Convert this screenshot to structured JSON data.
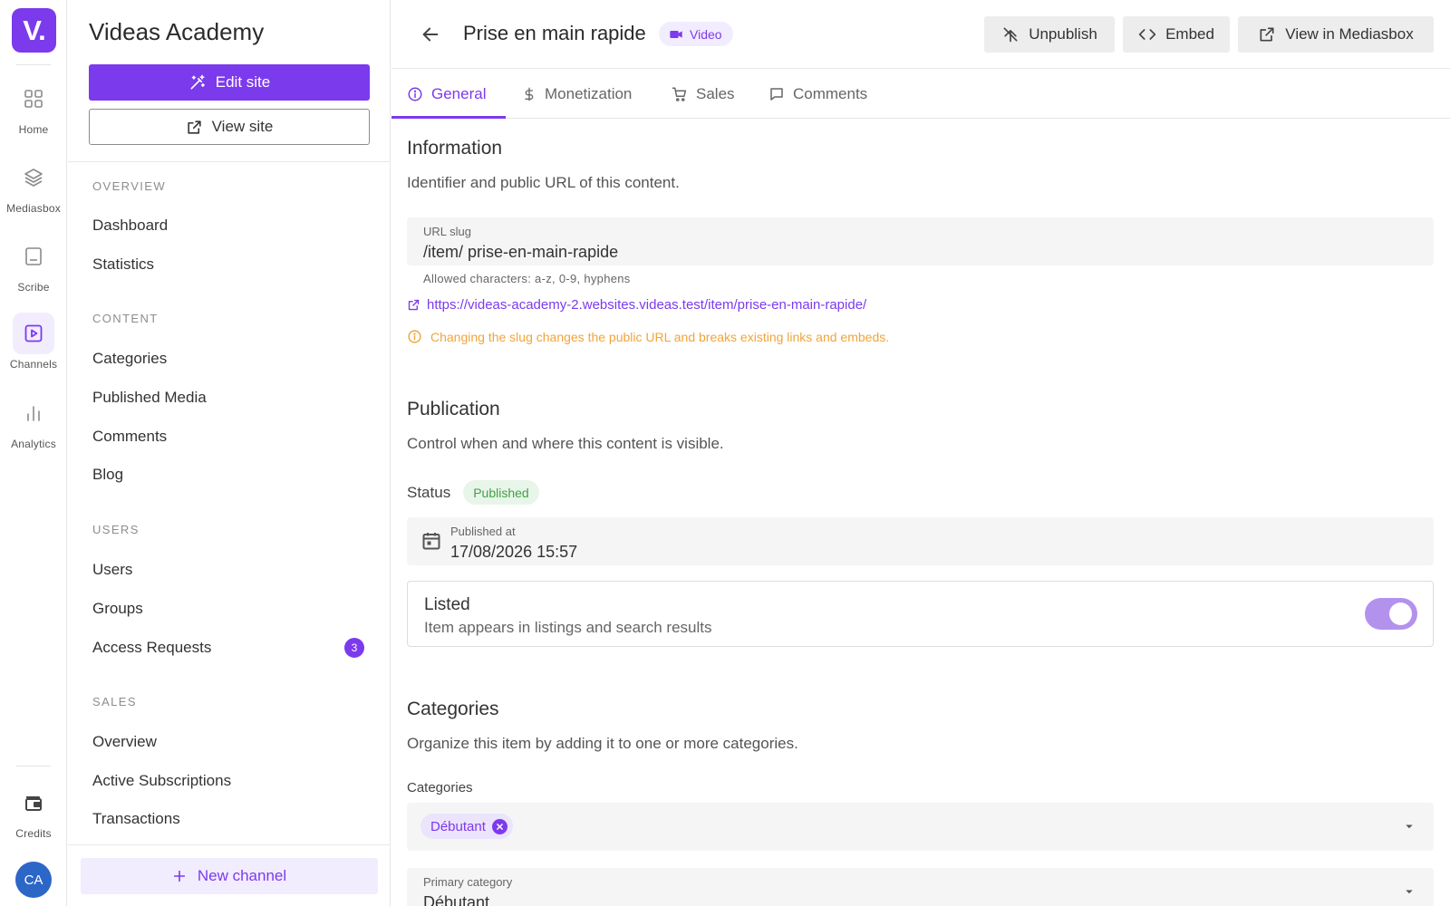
{
  "rail": {
    "logo": "V.",
    "items": [
      {
        "label": "Home",
        "icon": "grid-icon"
      },
      {
        "label": "Mediasbox",
        "icon": "layers-icon"
      },
      {
        "label": "Scribe",
        "icon": "scribe-icon"
      },
      {
        "label": "Channels",
        "icon": "play-square-icon",
        "active": true
      },
      {
        "label": "Analytics",
        "icon": "bar-chart-icon"
      },
      {
        "label": "Credits",
        "icon": "wallet-icon"
      }
    ],
    "avatar_initials": "CA"
  },
  "sidebar": {
    "site_title": "Videas Academy",
    "edit_site": "Edit site",
    "view_site": "View site",
    "sections": [
      {
        "title": "OVERVIEW",
        "items": [
          "Dashboard",
          "Statistics"
        ]
      },
      {
        "title": "CONTENT",
        "items": [
          "Categories",
          "Published Media",
          "Comments",
          "Blog"
        ]
      },
      {
        "title": "USERS",
        "items": [
          "Users",
          "Groups",
          "Access Requests"
        ]
      },
      {
        "title": "SALES",
        "items": [
          "Overview",
          "Active Subscriptions",
          "Transactions"
        ]
      }
    ],
    "access_requests_badge": "3",
    "new_channel": "New channel"
  },
  "header": {
    "title": "Prise en main rapide",
    "type_chip": "Video",
    "unpublish": "Unpublish",
    "embed": "Embed",
    "view_in_mediasbox": "View in Mediasbox"
  },
  "tabs": [
    {
      "label": "General",
      "icon": "info-icon",
      "active": true
    },
    {
      "label": "Monetization",
      "icon": "dollar-icon"
    },
    {
      "label": "Sales",
      "icon": "cart-icon"
    },
    {
      "label": "Comments",
      "icon": "comment-icon"
    }
  ],
  "information": {
    "title": "Information",
    "subtitle": "Identifier and public URL of this content.",
    "slug_label": "URL slug",
    "slug_prefix": "/item/",
    "slug_value": "prise-en-main-rapide",
    "slug_hint": "Allowed characters: a-z, 0-9, hyphens",
    "public_url": "https://videas-academy-2.websites.videas.test/item/prise-en-main-rapide/",
    "warning": "Changing the slug changes the public URL and breaks existing links and embeds."
  },
  "publication": {
    "title": "Publication",
    "subtitle": "Control when and where this content is visible.",
    "status_label": "Status",
    "status_value": "Published",
    "published_at_label": "Published at",
    "published_at_value": "17/08/2026 15:57",
    "listed_title": "Listed",
    "listed_subtitle": "Item appears in listings and search results",
    "listed_on": true
  },
  "categories": {
    "title": "Categories",
    "subtitle": "Organize this item by adding it to one or more categories.",
    "field_label": "Categories",
    "selected": [
      "Débutant"
    ],
    "primary_label": "Primary category",
    "primary_value": "Débutant"
  },
  "colors": {
    "accent": "#7c3aed",
    "accent_light": "#f2ecff",
    "success": "#43a047",
    "warning": "#f0a43a",
    "avatar": "#2c66c7"
  }
}
